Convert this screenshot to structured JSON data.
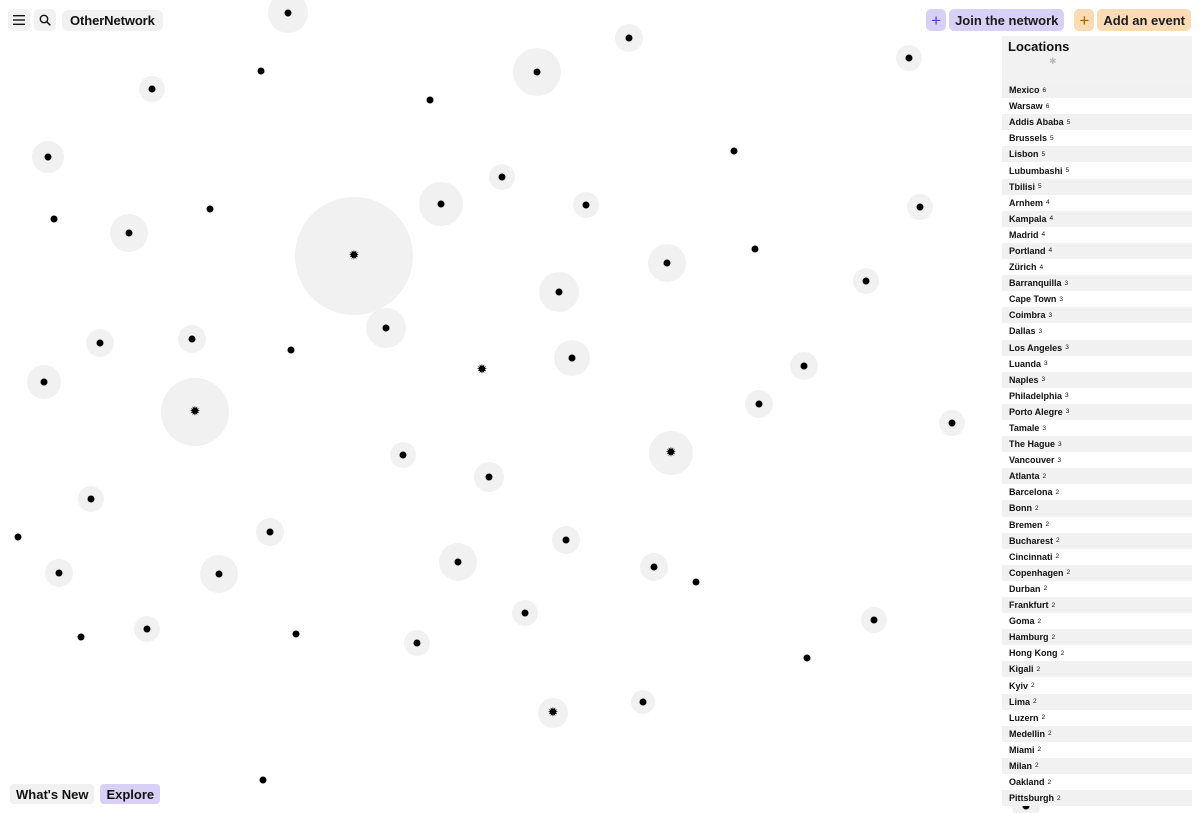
{
  "app": {
    "name": "OtherNetwork"
  },
  "header": {
    "join_label": "Join the network",
    "add_event_label": "Add an event",
    "accent_purple": "#d9d0f5",
    "accent_orange": "#fbdbb4"
  },
  "icons": {
    "menu": "hamburger-icon",
    "search": "magnifier-icon",
    "plus": "+",
    "star": "✹"
  },
  "locations": {
    "title": "Locations",
    "items": [
      {
        "name": "Mexico",
        "count": "6"
      },
      {
        "name": "Warsaw",
        "count": "6"
      },
      {
        "name": "Addis Ababa",
        "count": "5"
      },
      {
        "name": "Brussels",
        "count": "5"
      },
      {
        "name": "Lisbon",
        "count": "5"
      },
      {
        "name": "Lubumbashi",
        "count": "5"
      },
      {
        "name": "Tbilisi",
        "count": "5"
      },
      {
        "name": "Arnhem",
        "count": "4"
      },
      {
        "name": "Kampala",
        "count": "4"
      },
      {
        "name": "Madrid",
        "count": "4"
      },
      {
        "name": "Portland",
        "count": "4"
      },
      {
        "name": "Zürich",
        "count": "4"
      },
      {
        "name": "Barranquilla",
        "count": "3"
      },
      {
        "name": "Cape Town",
        "count": "3"
      },
      {
        "name": "Coimbra",
        "count": "3"
      },
      {
        "name": "Dallas",
        "count": "3"
      },
      {
        "name": "Los Angeles",
        "count": "3"
      },
      {
        "name": "Luanda",
        "count": "3"
      },
      {
        "name": "Naples",
        "count": "3"
      },
      {
        "name": "Philadelphia",
        "count": "3"
      },
      {
        "name": "Porto Alegre",
        "count": "3"
      },
      {
        "name": "Tamale",
        "count": "3"
      },
      {
        "name": "The Hague",
        "count": "3"
      },
      {
        "name": "Vancouver",
        "count": "3"
      },
      {
        "name": "Atlanta",
        "count": "2"
      },
      {
        "name": "Barcelona",
        "count": "2"
      },
      {
        "name": "Bonn",
        "count": "2"
      },
      {
        "name": "Bremen",
        "count": "2"
      },
      {
        "name": "Bucharest",
        "count": "2"
      },
      {
        "name": "Cincinnati",
        "count": "2"
      },
      {
        "name": "Copenhagen",
        "count": "2"
      },
      {
        "name": "Durban",
        "count": "2"
      },
      {
        "name": "Frankfurt",
        "count": "2"
      },
      {
        "name": "Goma",
        "count": "2"
      },
      {
        "name": "Hamburg",
        "count": "2"
      },
      {
        "name": "Hong Kong",
        "count": "2"
      },
      {
        "name": "Kigali",
        "count": "2"
      },
      {
        "name": "Kyiv",
        "count": "2"
      },
      {
        "name": "Lima",
        "count": "2"
      },
      {
        "name": "Luzern",
        "count": "2"
      },
      {
        "name": "Medellin",
        "count": "2"
      },
      {
        "name": "Miami",
        "count": "2"
      },
      {
        "name": "Milan",
        "count": "2"
      },
      {
        "name": "Oakland",
        "count": "2"
      },
      {
        "name": "Pittsburgh",
        "count": "2"
      }
    ]
  },
  "footer": {
    "whats_new_label": "What's New",
    "explore_label": "Explore"
  }
}
